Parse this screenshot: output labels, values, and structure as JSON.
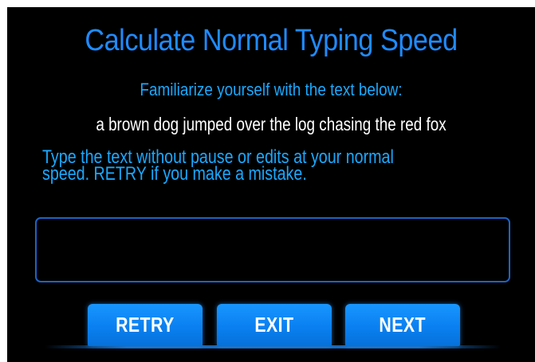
{
  "header": {
    "title": "Calculate Normal Typing Speed",
    "subtitle": "Familiarize yourself with the text below:"
  },
  "sample_text": "a brown dog jumped over the log chasing the red fox",
  "instructions": {
    "line1": "Type the text without pause or edits at your normal",
    "line2": "speed. RETRY if you make a mistake."
  },
  "typing_input": {
    "value": "",
    "placeholder": ""
  },
  "buttons": {
    "retry": "RETRY",
    "exit": "EXIT",
    "next": "NEXT"
  },
  "colors": {
    "background": "#000000",
    "title": "#1f8bff",
    "accent_text": "#1aa9ff",
    "sample_text": "#ffffff",
    "input_border": "#1d63c8",
    "button_fill": "#0a80f0"
  }
}
